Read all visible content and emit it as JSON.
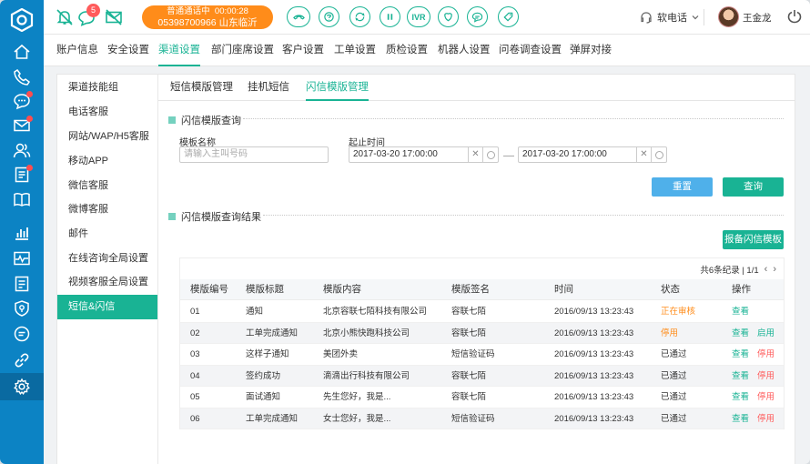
{
  "rail": {
    "items": [
      {
        "name": "home-icon",
        "dot": false
      },
      {
        "name": "phone-icon",
        "dot": false
      },
      {
        "name": "chat-icon",
        "dot": true
      },
      {
        "name": "mail-icon",
        "dot": true
      },
      {
        "name": "users-icon",
        "dot": false
      },
      {
        "name": "list-icon",
        "dot": true
      },
      {
        "name": "book-icon",
        "dot": false
      },
      {
        "name": "bar-chart-icon",
        "dot": false
      },
      {
        "name": "monitor-icon",
        "dot": false
      },
      {
        "name": "checklist-icon",
        "dot": false
      },
      {
        "name": "shield-icon",
        "dot": false
      },
      {
        "name": "message-icon",
        "dot": false
      },
      {
        "name": "link-icon",
        "dot": false
      },
      {
        "name": "settings-icon",
        "dot": false
      }
    ]
  },
  "topbar": {
    "notification_count": "5",
    "call": {
      "status": "普通通话中",
      "duration": "00:00:28",
      "number": "05398700966",
      "location": "山东临沂"
    },
    "controls": [
      "hangup",
      "consult",
      "transfer",
      "hold",
      "IVR",
      "satisfaction",
      "sms",
      "tag"
    ],
    "ivr_label": "IVR",
    "softphone_label": "软电话",
    "user_name": "王金龙"
  },
  "mainmenu": [
    "账户信息",
    "安全设置",
    "渠道设置",
    "部门座席设置",
    "客户设置",
    "工单设置",
    "质检设置",
    "机器人设置",
    "问卷调查设置",
    "弹屏对接"
  ],
  "sidemenu": [
    "渠道技能组",
    "电话客服",
    "网站/WAP/H5客服",
    "移动APP",
    "微信客服",
    "微博客服",
    "邮件",
    "在线咨询全局设置",
    "视频客服全局设置",
    "短信&闪信"
  ],
  "subtabs": [
    "短信模版管理",
    "挂机短信",
    "闪信模版管理"
  ],
  "query": {
    "section_title": "闪信模版查询",
    "name_label": "模板名称",
    "name_placeholder": "请输入主叫号码",
    "date_label": "起止时间",
    "start_date": "2017-03-20  17:00:00",
    "end_date": "2017-03-20  17:00:00",
    "reset_label": "重置",
    "search_label": "查询"
  },
  "results": {
    "section_title": "闪信模版查询结果",
    "report_button": "报备闪信模板",
    "pager_text": "共6条纪录 | 1/1",
    "headers": [
      "模版编号",
      "模版标题",
      "模版内容",
      "模版签名",
      "时间",
      "状态",
      "操作"
    ],
    "rows": [
      {
        "id": "01",
        "title": "通知",
        "content": "北京容联七陌科技有限公司",
        "sign": "容联七陌",
        "time": "2016/09/13   13:23:43",
        "status": "正在审核",
        "status_type": "pending",
        "op1": "查看",
        "op2": ""
      },
      {
        "id": "02",
        "title": "工单完成通知",
        "content": "北京小熊快跑科技公司",
        "sign": "容联七陌",
        "time": "2016/09/13   13:23:43",
        "status": "停用",
        "status_type": "disabled",
        "op1": "查看",
        "op2": "启用"
      },
      {
        "id": "03",
        "title": "这样子通知",
        "content": "美团外卖",
        "sign": "短信验证码",
        "time": "2016/09/13   13:23:43",
        "status": "已通过",
        "status_type": "ok",
        "op1": "查看",
        "op2": "停用"
      },
      {
        "id": "04",
        "title": "签约成功",
        "content": "滴滴出行科技有限公司",
        "sign": "容联七陌",
        "time": "2016/09/13   13:23:43",
        "status": "已通过",
        "status_type": "ok",
        "op1": "查看",
        "op2": "停用"
      },
      {
        "id": "05",
        "title": "面试通知",
        "content": "先生您好，我是...",
        "sign": "容联七陌",
        "time": "2016/09/13   13:23:43",
        "status": "已通过",
        "status_type": "ok",
        "op1": "查看",
        "op2": "停用"
      },
      {
        "id": "06",
        "title": "工单完成通知",
        "content": "女士您好，我是...",
        "sign": "短信验证码",
        "time": "2016/09/13   13:23:43",
        "status": "已通过",
        "status_type": "ok",
        "op1": "查看",
        "op2": "停用"
      }
    ]
  },
  "colors": {
    "rail": "#0c83c4",
    "accent": "#19b394",
    "call": "#ff8c1a",
    "danger": "#ff5b5b",
    "reset": "#4fb0ea"
  }
}
